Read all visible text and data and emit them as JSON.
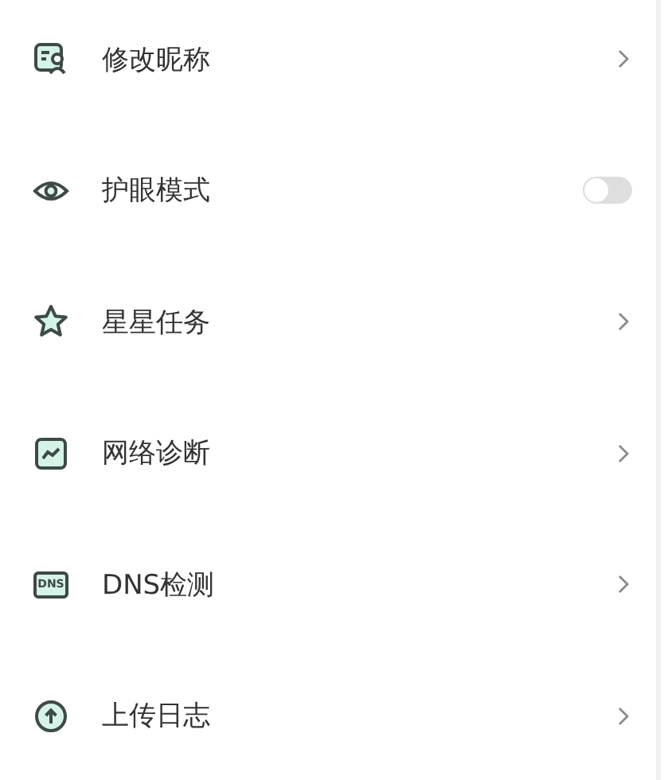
{
  "settings": [
    {
      "label": "修改昵称",
      "kind": "link"
    },
    {
      "label": "护眼模式",
      "kind": "toggle",
      "on": false
    },
    {
      "label": "星星任务",
      "kind": "link"
    },
    {
      "label": "网络诊断",
      "kind": "link"
    },
    {
      "label": "DNS检测",
      "kind": "link",
      "icon_text": "DNS"
    },
    {
      "label": "上传日志",
      "kind": "link"
    }
  ]
}
